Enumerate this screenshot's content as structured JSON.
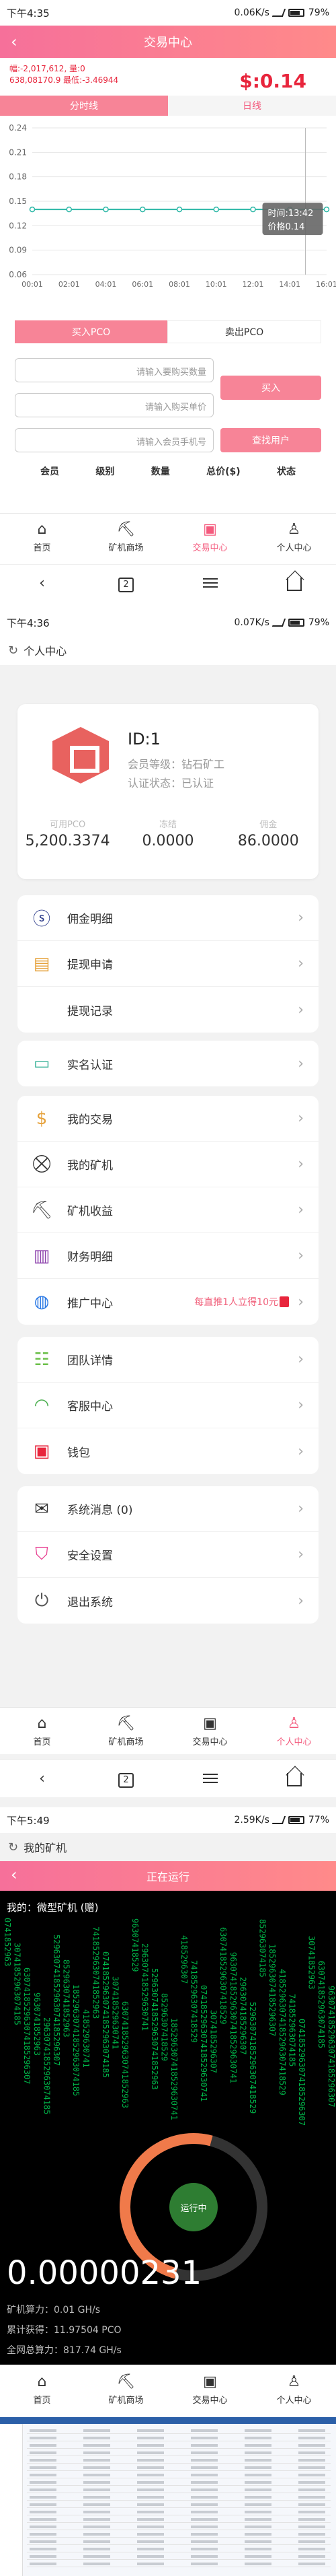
{
  "status1": {
    "time": "下午4:35",
    "speed": "0.06K/s",
    "battery": "79%"
  },
  "status2": {
    "time": "下午4:36",
    "speed": "0.07K/s",
    "battery": "79%"
  },
  "status3": {
    "time": "下午5:49",
    "speed": "2.59K/s",
    "battery": "77%"
  },
  "trade": {
    "title": "交易中心",
    "line1": "幅:-2,017,612, 量:0",
    "line2": "638,08170.9 最低:-3.46944",
    "price": "$:0.14",
    "tab_time": "分时线",
    "tab_day": "日线",
    "tooltip_time": "时间:13:42",
    "tooltip_price": "价格0.14",
    "buy_tab": "买入PCO",
    "sell_tab": "卖出PCO",
    "ph_amount": "请输入要购买数量",
    "ph_price": "请输入购买单价",
    "ph_phone": "请输入会员手机号",
    "buy_btn": "买入",
    "find_btn": "查找用户",
    "cols": [
      "会员",
      "级别",
      "数量",
      "总价($)",
      "状态"
    ]
  },
  "chart_data": {
    "type": "line",
    "title": "",
    "xlabel": "",
    "ylabel": "",
    "x": [
      "00:01",
      "02:01",
      "04:01",
      "06:01",
      "08:01",
      "10:01",
      "12:01",
      "14:01",
      "16:01"
    ],
    "values": [
      0.14,
      0.14,
      0.14,
      0.14,
      0.14,
      0.14,
      0.14,
      0.14,
      0.14
    ],
    "yticks": [
      "0.24",
      "0.21",
      "0.18",
      "0.15",
      "0.12",
      "0.09",
      "0.06"
    ],
    "ylim": [
      0.06,
      0.24
    ],
    "color": "#2db8a7"
  },
  "tabbar": {
    "home": "首页",
    "miner_shop": "矿机商场",
    "trade": "交易中心",
    "me": "个人中心"
  },
  "nav": {
    "tabs_count": "2"
  },
  "profile": {
    "title": "个人中心",
    "id": "ID:1",
    "level": "会员等级：钻石矿工",
    "auth": "认证状态：已认证",
    "bal_label": "可用PCO",
    "bal": "5,200.3374",
    "frozen_label": "冻结",
    "frozen": "0.0000",
    "comm_label": "佣金",
    "comm": "86.0000"
  },
  "menu1": [
    "佣金明细",
    "提现申请",
    "提现记录"
  ],
  "menu2": [
    "实名认证"
  ],
  "menu3": [
    "我的交易",
    "我的矿机",
    "矿机收益",
    "财务明细",
    "推广中心"
  ],
  "promo": "每直推1人立得10元",
  "menu4": [
    "团队详情",
    "客服中心",
    "钱包"
  ],
  "menu5": [
    "系统消息 (0)",
    "安全设置",
    "退出系统"
  ],
  "miner": {
    "page_title": "我的矿机",
    "header": "正在运行",
    "name": "我的：微型矿机 (赠)",
    "running": "运行中",
    "number": "0.00000231",
    "hashrate": "矿机算力：0.01 GH/s",
    "total": "累计获得：11.97504 PCO",
    "network": "全网总算力：817.74 GH/s"
  },
  "colors": {
    "accent": "#f45a7d",
    "pink_grad_start": "#f6709a",
    "pink_grad_end": "#ff8a8a",
    "red": "#e8253c",
    "line": "#2db8a7"
  }
}
